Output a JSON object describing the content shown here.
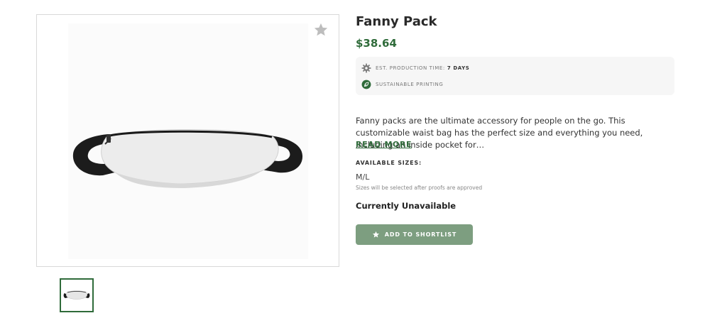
{
  "product": {
    "title": "Fanny Pack",
    "price": "$38.64",
    "image_alt": "white fanny pack with black strap"
  },
  "info": {
    "production_label": "EST. PRODUCTION TIME:",
    "production_value": "7 DAYS",
    "sustainable_label": "SUSTAINABLE PRINTING"
  },
  "description": {
    "text": "Fanny packs are the ultimate accessory for people on the go. This customizable waist bag has the perfect size and everything you need, including an inside pocket for…",
    "read_more": "READ MORE"
  },
  "sizes": {
    "label": "AVAILABLE SIZES:",
    "value": "M/L",
    "note": "Sizes will be selected after proofs are approved"
  },
  "availability": {
    "status": "Currently Unavailable"
  },
  "actions": {
    "shortlist_label": "ADD TO SHORTLIST"
  },
  "icons": {
    "favorite": "star-icon",
    "production": "gear-icon",
    "sustainable": "leaf-icon",
    "button": "star-icon"
  },
  "colors": {
    "accent_green": "#2f6b3a",
    "button_bg": "#7d9e80",
    "info_bg": "#f6f6f6"
  }
}
